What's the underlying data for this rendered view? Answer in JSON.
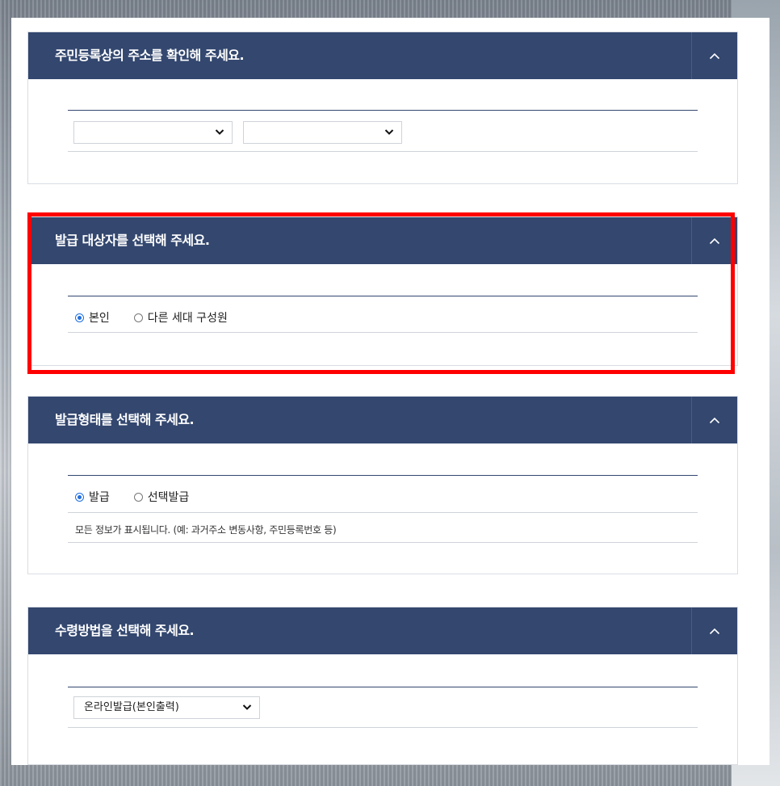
{
  "sections": [
    {
      "title": "주민등록상의 주소를 확인해 주세요.",
      "select1": "",
      "select2": ""
    },
    {
      "title": "발급 대상자를 선택해 주세요.",
      "options": [
        "본인",
        "다른 세대 구성원"
      ],
      "selected": 0
    },
    {
      "title": "발급형태를 선택해 주세요.",
      "options": [
        "발급",
        "선택발급"
      ],
      "selected": 0,
      "description": "모든 정보가 표시됩니다. (예: 과거주소 변동사항, 주민등록번호 등)"
    },
    {
      "title": "수령방법을 선택해 주세요.",
      "select": "온라인발급(본인출력)"
    }
  ],
  "colors": {
    "header": "#33476f",
    "highlight": "#ff0000",
    "radio": "#1f6fe0"
  },
  "icons": {
    "toggle": "chevron-up-icon",
    "dropdown": "chevron-down-icon"
  }
}
